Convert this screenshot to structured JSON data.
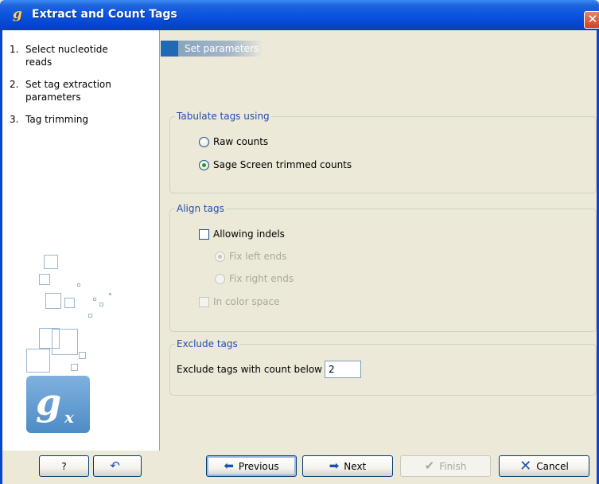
{
  "window": {
    "title": "Extract and Count Tags",
    "app_icon": "g",
    "close_glyph": "✕"
  },
  "steps": [
    {
      "num": "1.",
      "label": "Select nucleotide reads"
    },
    {
      "num": "2.",
      "label": "Set tag extraction parameters"
    },
    {
      "num": "3.",
      "label": "Tag trimming"
    }
  ],
  "logo": {
    "letter": "g",
    "sub": "x"
  },
  "section": {
    "title": "Set parameters"
  },
  "tabulate": {
    "legend": "Tabulate tags using",
    "raw_counts": "Raw counts",
    "sage_counts": "Sage Screen trimmed counts"
  },
  "align": {
    "legend": "Align tags",
    "allowing_indels": "Allowing indels",
    "fix_left": "Fix left ends",
    "fix_right": "Fix right ends",
    "color_space": "In color space"
  },
  "exclude": {
    "legend": "Exclude tags",
    "label": "Exclude tags with count below",
    "value": "2"
  },
  "buttons": {
    "help": "?",
    "reset": "↶",
    "previous": "Previous",
    "next": "Next",
    "finish": "Finish",
    "cancel": "Cancel"
  },
  "icons": {
    "previous": "arrow-left-icon",
    "next": "arrow-right-icon",
    "finish": "checkmark-icon",
    "cancel": "x-icon",
    "reset": "undo-icon"
  },
  "colors": {
    "titlebar": "#0a54e0",
    "legend_text": "#1f4fae",
    "section_header": "#7f9db9",
    "logo": "#4e8cc6"
  }
}
